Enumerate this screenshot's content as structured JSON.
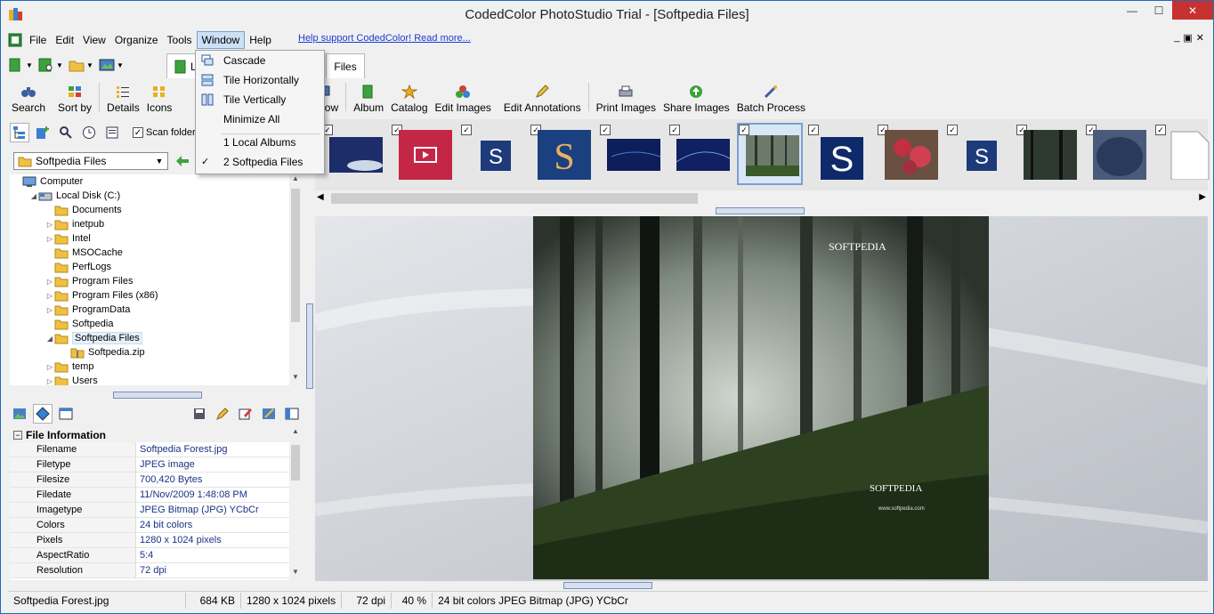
{
  "window": {
    "title": "CodedColor PhotoStudio Trial - [Softpedia Files]",
    "controls": {
      "minimize": "—",
      "maximize": "☐",
      "close": "✕"
    }
  },
  "menubar": {
    "items": [
      "File",
      "Edit",
      "View",
      "Organize",
      "Tools",
      "Window",
      "Help"
    ],
    "help_link": "Help support CodedColor! Read more...",
    "mdi": {
      "minimize": "_",
      "restore": "▣",
      "close": "✕"
    }
  },
  "tabs": {
    "location_short": "Lo",
    "files_tab": "Files"
  },
  "toolbar": {
    "left": [
      "Search",
      "Sort by",
      "Details",
      "Icons"
    ],
    "right": [
      "nshow",
      "Album",
      "Catalog",
      "Edit Images",
      "Edit Annotations",
      "Print Images",
      "Share Images",
      "Batch Process"
    ]
  },
  "window_menu": {
    "items": [
      "Cascade",
      "Tile Horizontally",
      "Tile Vertically",
      "Minimize All"
    ],
    "windows": [
      "1 Local Albums",
      "2 Softpedia Files"
    ],
    "checked": "2 Softpedia Files"
  },
  "left_panel": {
    "scan_folders": "Scan folders",
    "folder_combo": "Softpedia Files",
    "tree": [
      {
        "label": "Computer",
        "level": 0,
        "exp": ""
      },
      {
        "label": "Local Disk (C:)",
        "level": 1,
        "exp": "◢"
      },
      {
        "label": "Documents",
        "level": 2,
        "exp": ""
      },
      {
        "label": "inetpub",
        "level": 2,
        "exp": "▷"
      },
      {
        "label": "Intel",
        "level": 2,
        "exp": "▷"
      },
      {
        "label": "MSOCache",
        "level": 2,
        "exp": ""
      },
      {
        "label": "PerfLogs",
        "level": 2,
        "exp": ""
      },
      {
        "label": "Program Files",
        "level": 2,
        "exp": "▷"
      },
      {
        "label": "Program Files (x86)",
        "level": 2,
        "exp": "▷"
      },
      {
        "label": "ProgramData",
        "level": 2,
        "exp": "▷"
      },
      {
        "label": "Softpedia",
        "level": 2,
        "exp": ""
      },
      {
        "label": "Softpedia Files",
        "level": 2,
        "exp": "◢",
        "selected": true
      },
      {
        "label": "Softpedia.zip",
        "level": 3,
        "exp": ""
      },
      {
        "label": "temp",
        "level": 2,
        "exp": "▷"
      },
      {
        "label": "Users",
        "level": 2,
        "exp": "▷"
      }
    ]
  },
  "file_info": {
    "header": "File Information",
    "rows": [
      {
        "key": "Filename",
        "value": "Softpedia Forest.jpg"
      },
      {
        "key": "Filetype",
        "value": "JPEG image"
      },
      {
        "key": "Filesize",
        "value": "700,420 Bytes"
      },
      {
        "key": "Filedate",
        "value": "11/Nov/2009 1:48:08 PM"
      },
      {
        "key": "Imagetype",
        "value": "JPEG Bitmap (JPG) YCbCr"
      },
      {
        "key": "Colors",
        "value": "24 bit colors"
      },
      {
        "key": "Pixels",
        "value": "1280 x 1024 pixels"
      },
      {
        "key": "AspectRatio",
        "value": "5:4"
      },
      {
        "key": "Resolution",
        "value": "72 dpi"
      }
    ]
  },
  "preview": {
    "watermark_top": "SOFTPEDIA",
    "watermark_bottom": "SOFTPEDIA",
    "watermark_url": "www.softpedia.com"
  },
  "statusbar": {
    "filename": "Softpedia Forest.jpg",
    "size": "684 KB",
    "dimensions": "1280 x 1024 pixels",
    "dpi": "72 dpi",
    "zoom": "40 %",
    "colorinfo": "24 bit colors JPEG Bitmap (JPG) YCbCr"
  },
  "colors": {
    "accent_blue": "#1e6bb8",
    "close_red": "#c7312f",
    "link_blue": "#1a3bd3",
    "value_blue": "#1a3384"
  }
}
